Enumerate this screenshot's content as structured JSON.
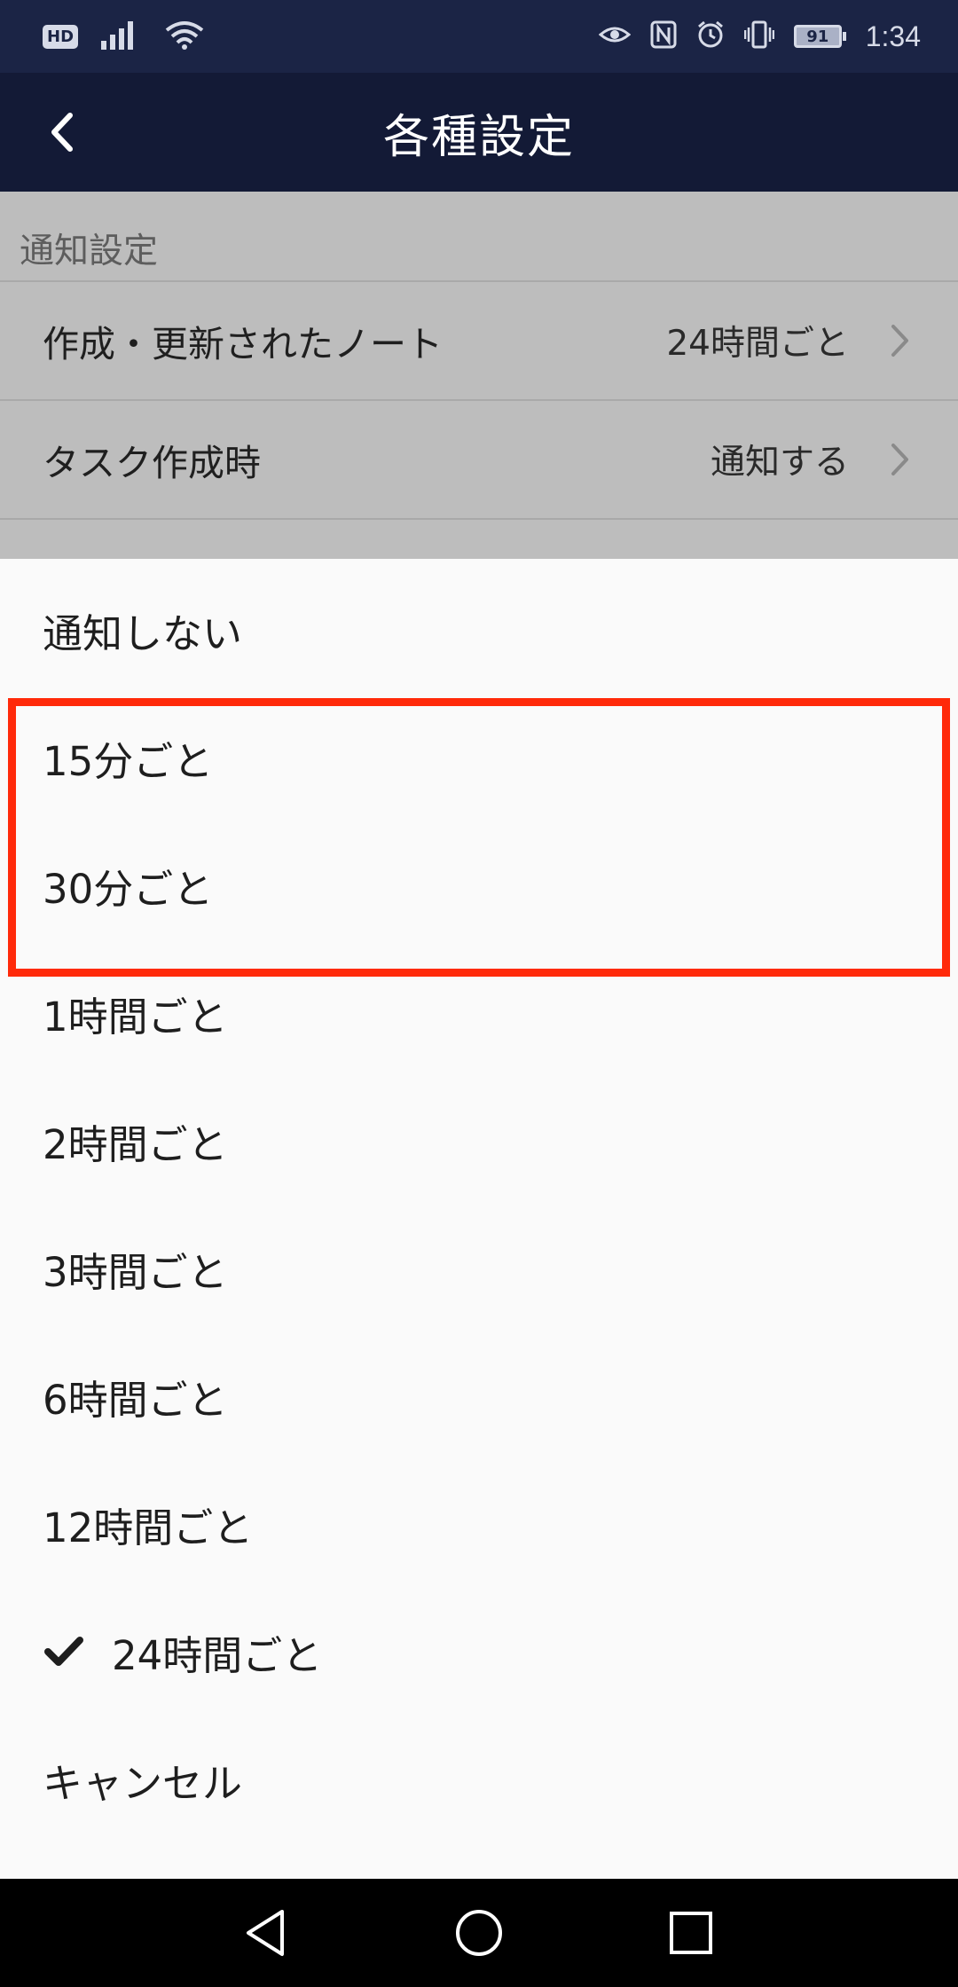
{
  "status_bar": {
    "hd_label": "HD",
    "battery_level": "91",
    "time": "1:34",
    "icons": [
      "signal-icon",
      "wifi-icon",
      "eye-comfort-icon",
      "nfc-icon",
      "alarm-icon",
      "vibrate-icon",
      "battery-icon"
    ]
  },
  "app_bar": {
    "title": "各種設定",
    "back_icon": "chevron-left-icon"
  },
  "settings": {
    "section_header": "通知設定",
    "rows": [
      {
        "label": "作成・更新されたノート",
        "value": "24時間ごと"
      },
      {
        "label": "タスク作成時",
        "value": "通知する"
      }
    ]
  },
  "sheet": {
    "options": [
      {
        "label": "通知しない",
        "selected": false
      },
      {
        "label": "15分ごと",
        "selected": false
      },
      {
        "label": "30分ごと",
        "selected": false
      },
      {
        "label": "1時間ごと",
        "selected": false
      },
      {
        "label": "2時間ごと",
        "selected": false
      },
      {
        "label": "3時間ごと",
        "selected": false
      },
      {
        "label": "6時間ごと",
        "selected": false
      },
      {
        "label": "12時間ごと",
        "selected": false
      },
      {
        "label": "24時間ごと",
        "selected": true
      }
    ],
    "cancel_label": "キャンセル"
  },
  "nav_bar": {
    "icons": [
      "back-triangle-icon",
      "home-circle-icon",
      "recents-square-icon"
    ]
  },
  "colors": {
    "status_bar_bg": "#1b2445",
    "app_bar_bg": "#131a36",
    "highlight": "#ff2a0a",
    "dim_overlay": "#bdbdbd"
  }
}
